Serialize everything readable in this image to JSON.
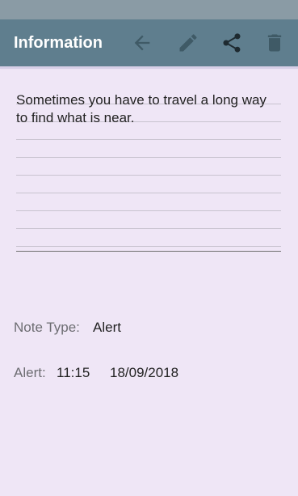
{
  "app_bar": {
    "title": "Information",
    "actions": [
      {
        "icon": "arrow-left-icon",
        "label": "back"
      },
      {
        "icon": "pencil-icon",
        "label": "edit"
      },
      {
        "icon": "share-icon",
        "label": "share"
      },
      {
        "icon": "trash-icon",
        "label": "delete"
      }
    ],
    "colors": {
      "background": "#5f7e8e",
      "status_bar": "#8a9ba5",
      "icon_dim": "#3f5a66",
      "icon_dark": "#1e2a30"
    }
  },
  "note": {
    "text": "Sometimes you have to travel a long way to find what is near."
  },
  "details": {
    "note_type_label": "Note Type:",
    "note_type_value": "Alert",
    "alert_label": "Alert:",
    "alert_time": "11:15",
    "alert_date": "18/09/2018"
  },
  "theme": {
    "page_background": "#efe6f6",
    "text_primary": "#222222",
    "text_secondary": "#6d6d72"
  }
}
